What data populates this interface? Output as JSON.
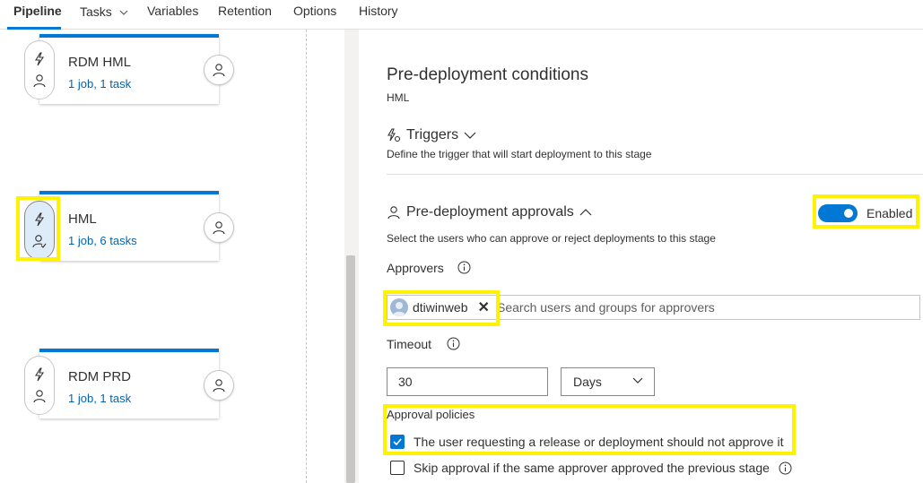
{
  "tabs": [
    {
      "label": "Pipeline",
      "active": true
    },
    {
      "label": "Tasks",
      "has_dropdown": true
    },
    {
      "label": "Variables"
    },
    {
      "label": "Retention"
    },
    {
      "label": "Options"
    },
    {
      "label": "History"
    }
  ],
  "stages": [
    {
      "name": "RDM HML",
      "summary": "1 job, 1 task"
    },
    {
      "name": "HML",
      "summary": "1 job, 6 tasks",
      "selected": true
    },
    {
      "name": "RDM PRD",
      "summary": "1 job, 1 task"
    }
  ],
  "panel": {
    "title": "Pre-deployment conditions",
    "subtitle": "HML",
    "triggers": {
      "title": "Triggers",
      "description": "Define the trigger that will start deployment to this stage"
    },
    "approvals": {
      "title": "Pre-deployment approvals",
      "description": "Select the users who can approve or reject deployments to this stage",
      "toggle_label": "Enabled",
      "approvers_label": "Approvers",
      "approver_chip": "dtiwinweb",
      "search_placeholder": "Search users and groups for approvers",
      "timeout_label": "Timeout",
      "timeout_value": "30",
      "timeout_unit": "Days",
      "policies_label": "Approval policies",
      "policies": [
        {
          "label": "The user requesting a release or deployment should not approve it",
          "checked": true
        },
        {
          "label": "Skip approval if the same approver approved the previous stage",
          "checked": false
        }
      ]
    }
  },
  "colors": {
    "accent": "#0078d4",
    "highlight": "#fff200",
    "link": "#0063b1"
  }
}
